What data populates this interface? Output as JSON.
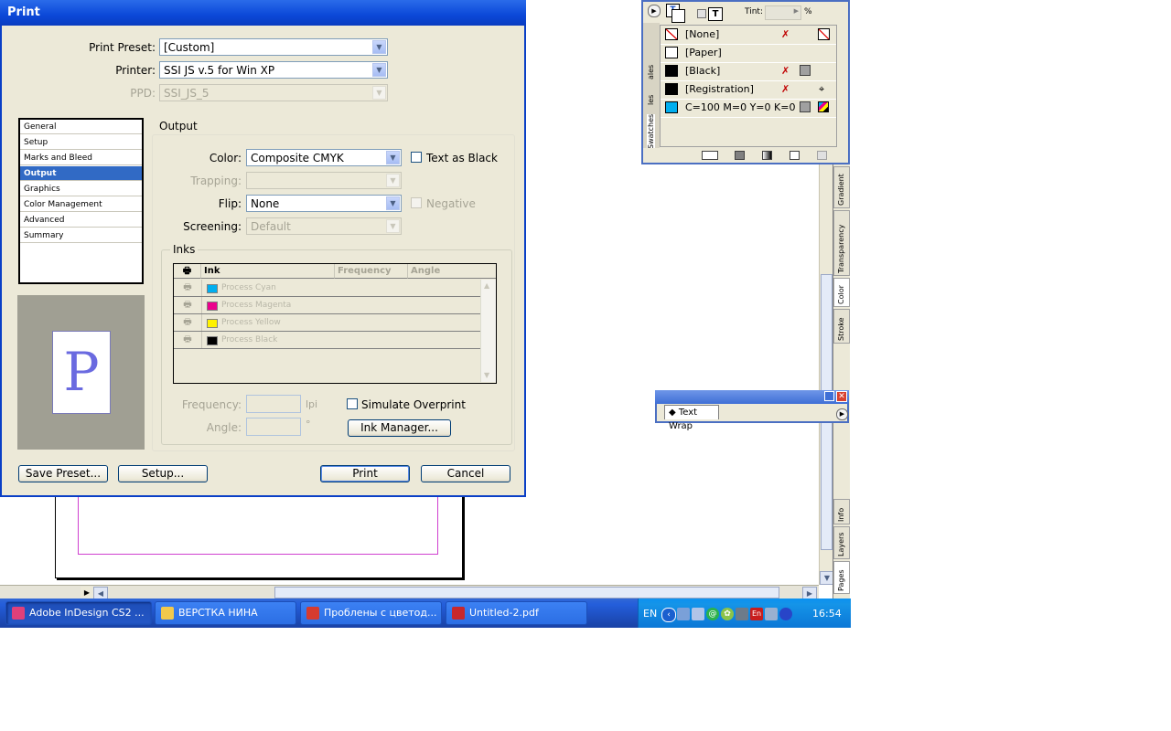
{
  "dialog": {
    "title": "Print",
    "print_preset_label": "Print Preset:",
    "print_preset_value": "[Custom]",
    "printer_label": "Printer:",
    "printer_value": "SSI JS v.5 for Win XP",
    "ppd_label": "PPD:",
    "ppd_value": "SSI_JS_5",
    "nav": [
      "General",
      "Setup",
      "Marks and Bleed",
      "Output",
      "Graphics",
      "Color Management",
      "Advanced",
      "Summary"
    ],
    "nav_selected": "Output",
    "preview_letter": "P",
    "output": {
      "section_title": "Output",
      "color_label": "Color:",
      "color_value": "Composite CMYK",
      "text_as_black": "Text as Black",
      "trapping_label": "Trapping:",
      "trapping_value": "",
      "flip_label": "Flip:",
      "flip_value": "None",
      "negative": "Negative",
      "screening_label": "Screening:",
      "screening_value": "Default"
    },
    "inks": {
      "title": "Inks",
      "columns": [
        "Ink",
        "Frequency",
        "Angle"
      ],
      "rows": [
        {
          "name": "Process Cyan",
          "color": "#00aeef"
        },
        {
          "name": "Process Magenta",
          "color": "#ec008c"
        },
        {
          "name": "Process Yellow",
          "color": "#fff200"
        },
        {
          "name": "Process Black",
          "color": "#000000"
        }
      ],
      "frequency_label": "Frequency:",
      "frequency_unit": "lpi",
      "angle_label": "Angle:",
      "angle_unit": "°",
      "simulate_overprint": "Simulate Overprint",
      "ink_manager": "Ink Manager..."
    },
    "buttons": {
      "save_preset": "Save Preset...",
      "setup": "Setup...",
      "print": "Print",
      "cancel": "Cancel"
    }
  },
  "swatches": {
    "tint_label": "Tint:",
    "tint_unit": "%",
    "tabs": [
      "Swatches",
      "les",
      "ales"
    ],
    "rows": [
      {
        "name": "[None]",
        "color": "#ffffff"
      },
      {
        "name": "[Paper]",
        "color": "#ffffff"
      },
      {
        "name": "[Black]",
        "color": "#000000"
      },
      {
        "name": "[Registration]",
        "color": "#000000"
      },
      {
        "name": "C=100 M=0 Y=0 K=0",
        "color": "#00aeef"
      }
    ]
  },
  "side_tabs": {
    "top": [
      "Gradient",
      "Transparency",
      "Color",
      "Stroke"
    ],
    "bottom": [
      "Info",
      "Layers",
      "Pages"
    ]
  },
  "text_wrap": {
    "tab_label": "Text Wrap"
  },
  "taskbar": {
    "items": [
      {
        "label": "Adobe InDesign CS2 ...",
        "icon_color": "#e0407a"
      },
      {
        "label": "ВЕРСТКА НИНА",
        "icon_color": "#f2c94c"
      },
      {
        "label": "Проблены с цветод...",
        "icon_color": "#d63b2f"
      },
      {
        "label": "Untitled-2.pdf",
        "icon_color": "#c8282c"
      }
    ],
    "lang": "EN",
    "clock": "16:54"
  }
}
